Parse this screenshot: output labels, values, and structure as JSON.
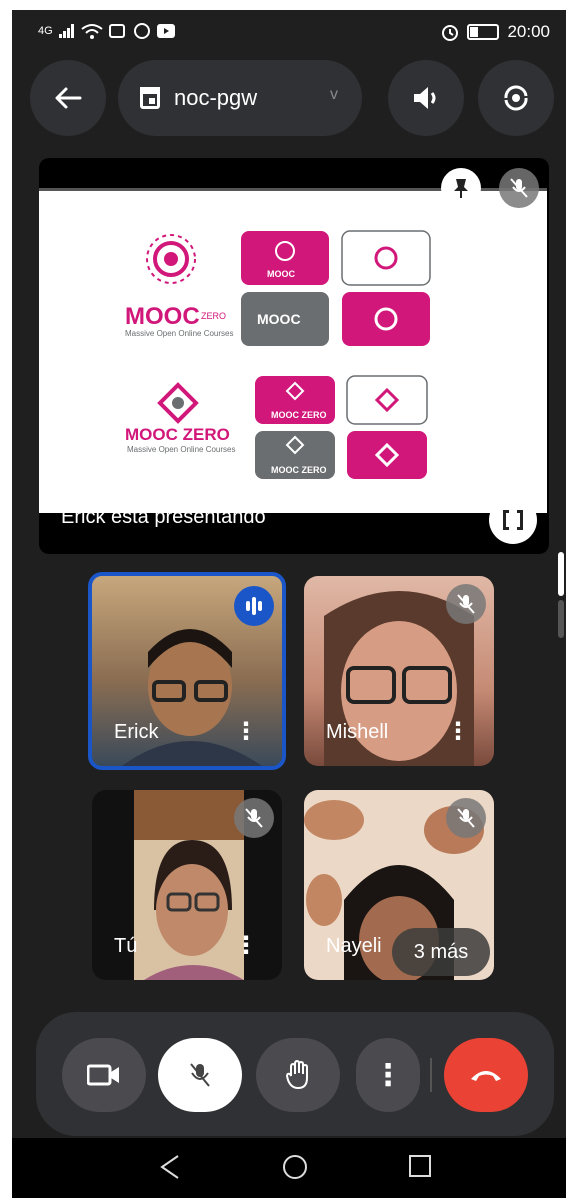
{
  "status_bar": {
    "network": "4G",
    "time": "20:00"
  },
  "meeting": {
    "code": "noc-pgw",
    "chevron": "v"
  },
  "presentation": {
    "caption": "Erick está presentando",
    "slide": {
      "brand_top": "MOOC",
      "brand_top_badge": "ZERO",
      "brand_top_sub": "Massive Open Online Courses",
      "brand_bottom": "MOOC ZERO",
      "brand_bottom_sub": "Massive Open Online Courses",
      "chip_mooc": "MOOC",
      "chip_mooc_zero": "MOOC ZERO"
    }
  },
  "participants": [
    {
      "name": "Erick"
    },
    {
      "name": "Mishell"
    },
    {
      "name": "Tú"
    },
    {
      "name": "Nayeli"
    }
  ],
  "more_label": "3 más",
  "icons": {
    "back": "arrow-left-icon",
    "calendar": "calendar-icon",
    "speaker": "volume-icon",
    "camera_switch": "camera-switch-icon",
    "pin": "pin-icon",
    "mic_off": "mic-off-icon",
    "fullscreen": "fullscreen-icon",
    "speaking": "audio-level-icon",
    "video": "video-icon",
    "hand": "raise-hand-icon",
    "more": "more-vert-icon",
    "end_call": "end-call-icon"
  },
  "colors": {
    "accent": "#1a56c8",
    "end_call": "#ea4335",
    "brand_pink": "#d1177a",
    "brand_gray": "#6a6e70"
  }
}
